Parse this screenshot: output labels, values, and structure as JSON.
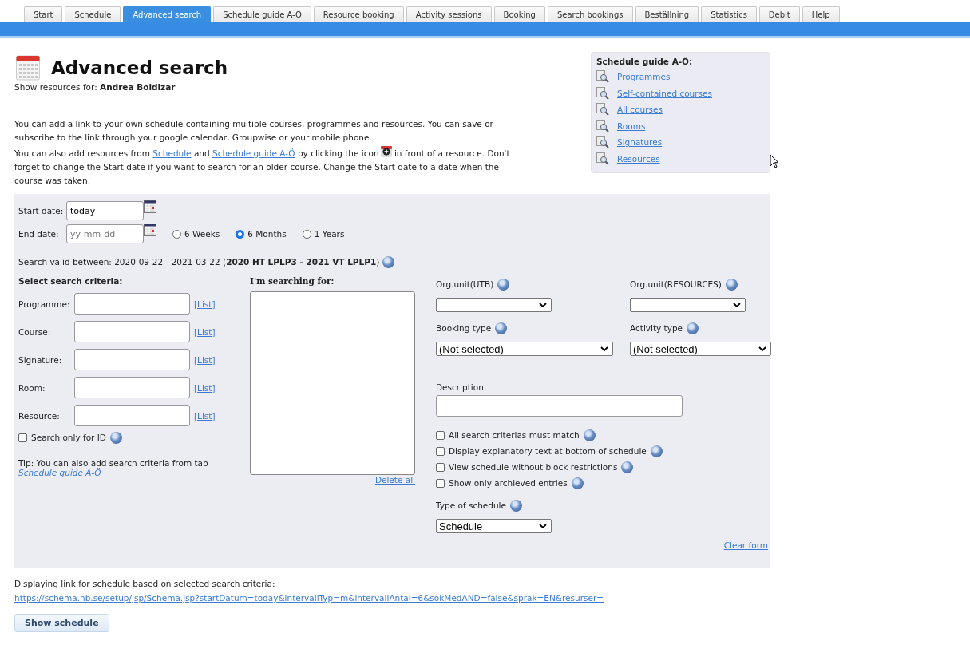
{
  "tabs": [
    {
      "label": "Start",
      "selected": false
    },
    {
      "label": "Schedule",
      "selected": false
    },
    {
      "label": "Advanced search",
      "selected": true
    },
    {
      "label": "Schedule guide A-Ö",
      "selected": false
    },
    {
      "label": "Resource booking",
      "selected": false
    },
    {
      "label": "Activity sessions",
      "selected": false
    },
    {
      "label": "Booking",
      "selected": false
    },
    {
      "label": "Search bookings",
      "selected": false
    },
    {
      "label": "Beställning",
      "selected": false
    },
    {
      "label": "Statistics",
      "selected": false
    },
    {
      "label": "Debit",
      "selected": false
    },
    {
      "label": "Help",
      "selected": false
    }
  ],
  "header": {
    "title": "Advanced search",
    "resources": "Show resources for: **Andrea Boldizar**"
  },
  "intro": "You can add a link to your own schedule containing multiple courses, programmes and resources. You can save or subscribe to the link through your google calendar, Groupwise or your mobile phone.",
  "intro_2": [
    {
      "kind": "text",
      "text": "You can also add resources from "
    },
    {
      "kind": "link",
      "text": "Schedule"
    },
    {
      "kind": "text",
      "text": " and "
    },
    {
      "kind": "link",
      "text": "Schedule guide A-Ö"
    },
    {
      "kind": "text",
      "text": " by clicking the icon"
    },
    {
      "kind": "icon"
    },
    {
      "kind": "text",
      "text": " in front of a resource. Don't forget to change the Start date if you want to search for an older course. Change the Start date to a date when the course was taken."
    }
  ],
  "guide": {
    "title": "Schedule guide A-Ö:",
    "links": [
      "Programmes",
      "Self-contained courses",
      "All courses",
      "Rooms",
      "Signatures",
      "Resources"
    ]
  },
  "dates": {
    "start_label": "Start date:",
    "start_value": "today",
    "end_label": "End date:",
    "end_placeholder": "yy-mm-dd"
  },
  "periods": [
    {
      "label": "6 Weeks",
      "selected": false
    },
    {
      "label": "6 Months",
      "selected": true
    },
    {
      "label": "1 Years",
      "selected": false
    }
  ],
  "valid": "Search valid between: 2020-09-22 - 2021-03-22 (**2020 HT LPLP3 - 2021 VT LPLP1**)",
  "criteria": {
    "title": "Select search criteria:",
    "fields": [
      {
        "label": "Programme:",
        "link": "[List]"
      },
      {
        "label": "Course:",
        "link": "[List]"
      },
      {
        "label": "Signature:",
        "link": "[List]"
      },
      {
        "label": "Room:",
        "link": "[List]"
      },
      {
        "label": "Resource:",
        "link": "[List]"
      }
    ],
    "id_only": {
      "label": "Search only for ID",
      "checked": false
    },
    "tip": "Tip: You can also add search criteria from tab",
    "tip_link": "Schedule guide A-Ö"
  },
  "selection": {
    "title": "I'm searching for:",
    "delete": "Delete all"
  },
  "filters": [
    {
      "label": "Org.unit(UTB)"
    },
    {
      "label": "Org.unit(RESOURCES)"
    },
    {
      "label": "Booking type",
      "value": "(Not selected)"
    },
    {
      "label": "Activity type",
      "value": "(Not selected)"
    }
  ],
  "description": {
    "label": "Description"
  },
  "options": [
    {
      "label": "All search criterias must match",
      "checked": false
    },
    {
      "label": "Display explanatory text at bottom of schedule",
      "checked": false
    },
    {
      "label": "View schedule without block restrictions",
      "checked": false
    },
    {
      "label": "Show only archieved entries",
      "checked": false
    }
  ],
  "schedule_type": {
    "label": "Type of schedule",
    "value": "Schedule"
  },
  "clear": "Clear form",
  "link_caption": "Displaying link for schedule based on selected search criteria:",
  "link_url": "https://schema.hb.se/setup/jsp/Schema.jsp?startDatum=today&intervallTyp=m&intervallAntal=6&sokMedAND=false&sprak=EN&resurser=",
  "show_button": "Show schedule"
}
